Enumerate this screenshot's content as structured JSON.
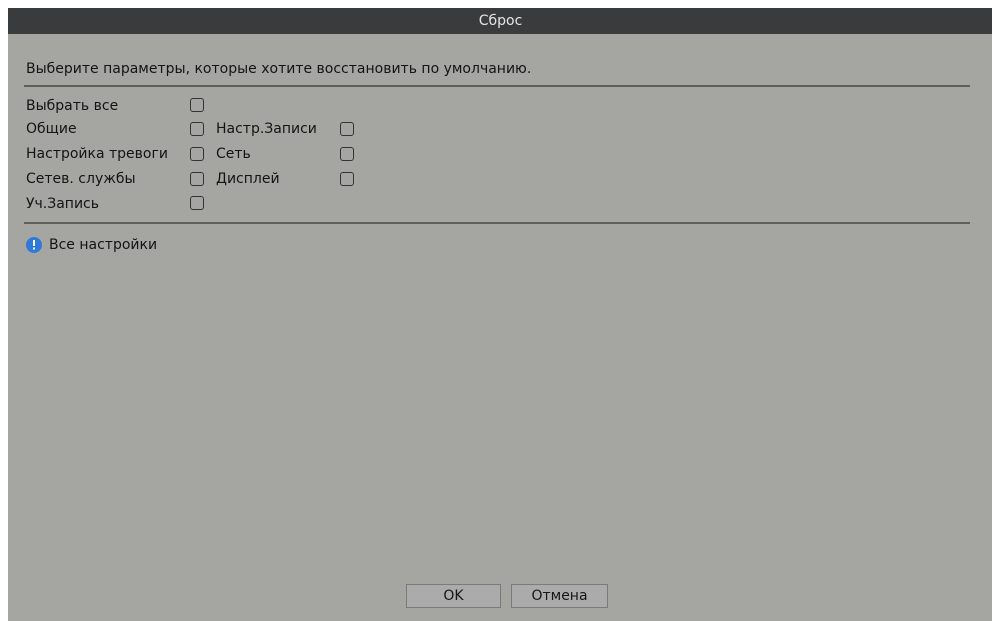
{
  "dialog": {
    "title": "Сброс",
    "instruction": "Выберите параметры, которые хотите восстановить по умолчанию.",
    "select_all": {
      "label": "Выбрать все",
      "checked": false
    },
    "options_left": [
      {
        "label": "Общие",
        "checked": false
      },
      {
        "label": "Настройка тревоги",
        "checked": false
      },
      {
        "label": "Сетев. службы",
        "checked": false
      },
      {
        "label": "Уч.Запись",
        "checked": false
      }
    ],
    "options_right": [
      {
        "label": "Настр.Записи",
        "checked": false
      },
      {
        "label": "Сеть",
        "checked": false
      },
      {
        "label": "Дисплей",
        "checked": false
      }
    ],
    "info": {
      "icon": "info-icon",
      "text": "Все настройки"
    },
    "buttons": {
      "ok": "OK",
      "cancel": "Отмена"
    }
  },
  "colors": {
    "background": "#a5a6a1",
    "titlebar": "#3a3b3d",
    "info_icon": "#2f7ad6"
  }
}
